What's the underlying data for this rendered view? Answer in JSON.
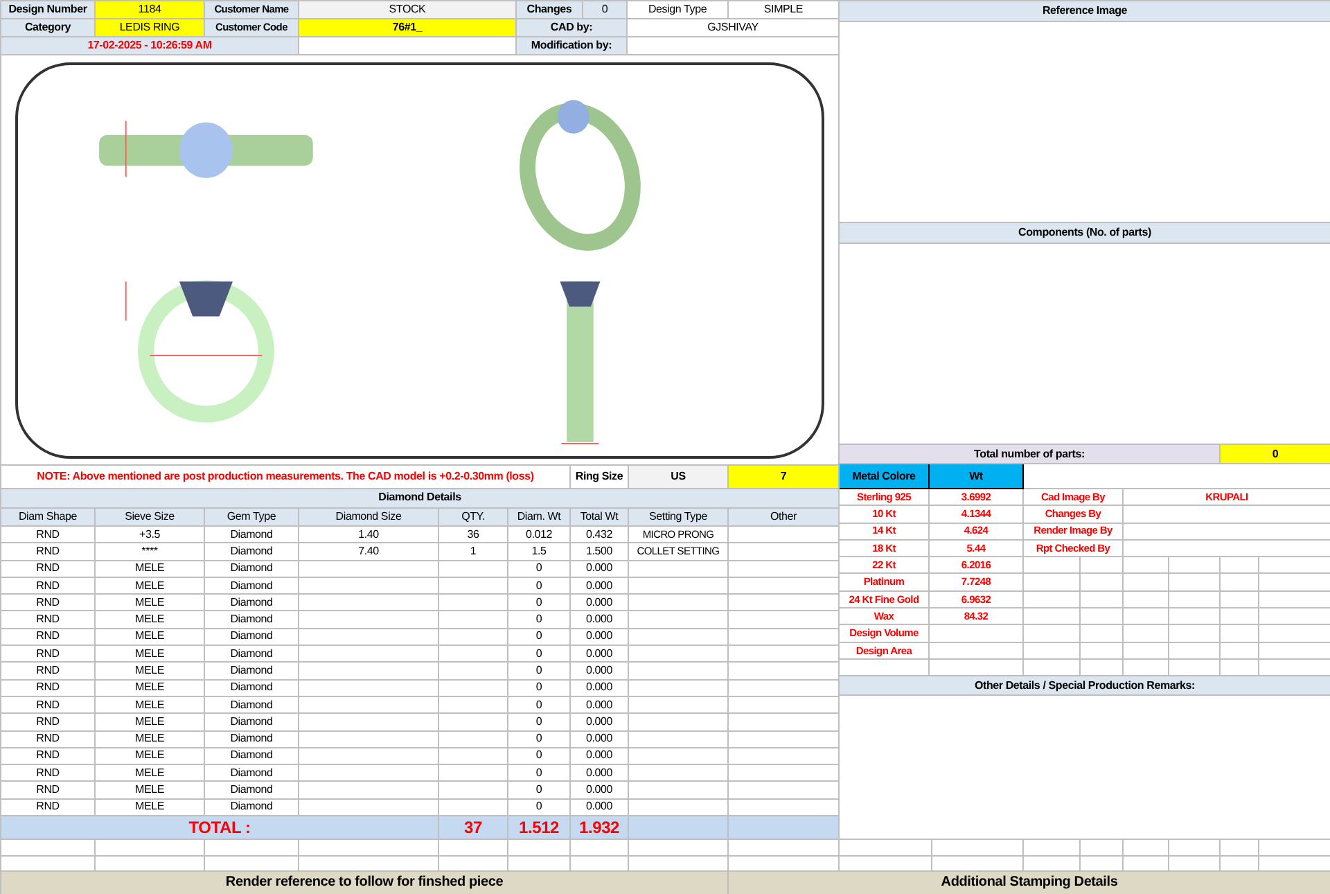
{
  "header": {
    "design_number": {
      "label": "Design Number",
      "value": "1184"
    },
    "customer_name": {
      "label": "Customer Name",
      "value": "STOCK"
    },
    "changes": {
      "label": "Changes",
      "value": "0"
    },
    "design_type": {
      "label": "Design Type",
      "value": "SIMPLE"
    },
    "category": {
      "label": "Category",
      "value": "LEDIS RING"
    },
    "customer_code": {
      "label": "Customer Code",
      "value": "76#1_"
    },
    "cad_by": {
      "label": "CAD by:",
      "value": "GJSHIVAY"
    },
    "timestamp": "17-02-2025 - 10:26:59 AM",
    "modification_by": {
      "label": "Modification by:"
    }
  },
  "note": "NOTE: Above mentioned are post production measurements. The CAD model is +0.2-0.30mm (loss)",
  "ring_size": {
    "label": "Ring Size",
    "system": "US",
    "value": "7"
  },
  "diamond_details": {
    "title": "Diamond Details",
    "columns": [
      "Diam Shape",
      "Sieve Size",
      "Gem Type",
      "Diamond Size",
      "QTY.",
      "Diam. Wt",
      "Total Wt",
      "Setting Type",
      "Other"
    ],
    "rows": [
      {
        "shape": "RND",
        "sieve": "+3.5",
        "gem": "Diamond",
        "size": "1.40",
        "qty": "36",
        "diam_wt": "0.012",
        "total_wt": "0.432",
        "setting": "MICRO PRONG"
      },
      {
        "shape": "RND",
        "sieve": "****",
        "gem": "Diamond",
        "size": "7.40",
        "qty": "1",
        "diam_wt": "1.5",
        "total_wt": "1.500",
        "setting": "COLLET SETTING"
      },
      {
        "shape": "RND",
        "sieve": "MELE",
        "gem": "Diamond",
        "diam_wt": "0",
        "total_wt": "0.000"
      },
      {
        "shape": "RND",
        "sieve": "MELE",
        "gem": "Diamond",
        "diam_wt": "0",
        "total_wt": "0.000"
      },
      {
        "shape": "RND",
        "sieve": "MELE",
        "gem": "Diamond",
        "diam_wt": "0",
        "total_wt": "0.000"
      },
      {
        "shape": "RND",
        "sieve": "MELE",
        "gem": "Diamond",
        "diam_wt": "0",
        "total_wt": "0.000"
      },
      {
        "shape": "RND",
        "sieve": "MELE",
        "gem": "Diamond",
        "diam_wt": "0",
        "total_wt": "0.000"
      },
      {
        "shape": "RND",
        "sieve": "MELE",
        "gem": "Diamond",
        "diam_wt": "0",
        "total_wt": "0.000"
      },
      {
        "shape": "RND",
        "sieve": "MELE",
        "gem": "Diamond",
        "diam_wt": "0",
        "total_wt": "0.000"
      },
      {
        "shape": "RND",
        "sieve": "MELE",
        "gem": "Diamond",
        "diam_wt": "0",
        "total_wt": "0.000"
      },
      {
        "shape": "RND",
        "sieve": "MELE",
        "gem": "Diamond",
        "diam_wt": "0",
        "total_wt": "0.000"
      },
      {
        "shape": "RND",
        "sieve": "MELE",
        "gem": "Diamond",
        "diam_wt": "0",
        "total_wt": "0.000"
      },
      {
        "shape": "RND",
        "sieve": "MELE",
        "gem": "Diamond",
        "diam_wt": "0",
        "total_wt": "0.000"
      },
      {
        "shape": "RND",
        "sieve": "MELE",
        "gem": "Diamond",
        "diam_wt": "0",
        "total_wt": "0.000"
      },
      {
        "shape": "RND",
        "sieve": "MELE",
        "gem": "Diamond",
        "diam_wt": "0",
        "total_wt": "0.000"
      },
      {
        "shape": "RND",
        "sieve": "MELE",
        "gem": "Diamond",
        "diam_wt": "0",
        "total_wt": "0.000"
      },
      {
        "shape": "RND",
        "sieve": "MELE",
        "gem": "Diamond",
        "diam_wt": "0",
        "total_wt": "0.000"
      }
    ],
    "total": {
      "label": "TOTAL :",
      "qty": "37",
      "diam_wt": "1.512",
      "total_wt": "1.932"
    }
  },
  "reference_image": {
    "title": "Reference Image"
  },
  "components": {
    "title": "Components (No. of parts)",
    "total_label": "Total number of parts:",
    "total": "0"
  },
  "metals": {
    "columns": [
      "Metal Colore",
      "Wt"
    ],
    "rows": [
      {
        "name": "Sterling 925",
        "wt": "3.6992"
      },
      {
        "name": "10 Kt",
        "wt": "4.1344"
      },
      {
        "name": "14 Kt",
        "wt": "4.624"
      },
      {
        "name": "18 Kt",
        "wt": "5.44"
      },
      {
        "name": "22 Kt",
        "wt": "6.2016"
      },
      {
        "name": "Platinum",
        "wt": "7.7248"
      },
      {
        "name": "24 Kt Fine Gold",
        "wt": "6.9632"
      },
      {
        "name": "Wax",
        "wt": "84.32"
      },
      {
        "name": "Design Volume"
      },
      {
        "name": "Design Area"
      }
    ]
  },
  "credits": [
    {
      "role": "Cad Image By",
      "name": "KRUPALI"
    },
    {
      "role": "Changes By"
    },
    {
      "role": "Render Image By"
    },
    {
      "role": "Rpt Checked By"
    }
  ],
  "other_details": {
    "title": "Other Details / Special Production Remarks:"
  },
  "footer": [
    "Render reference to follow for finshed piece",
    "Additional Stamping Details"
  ]
}
